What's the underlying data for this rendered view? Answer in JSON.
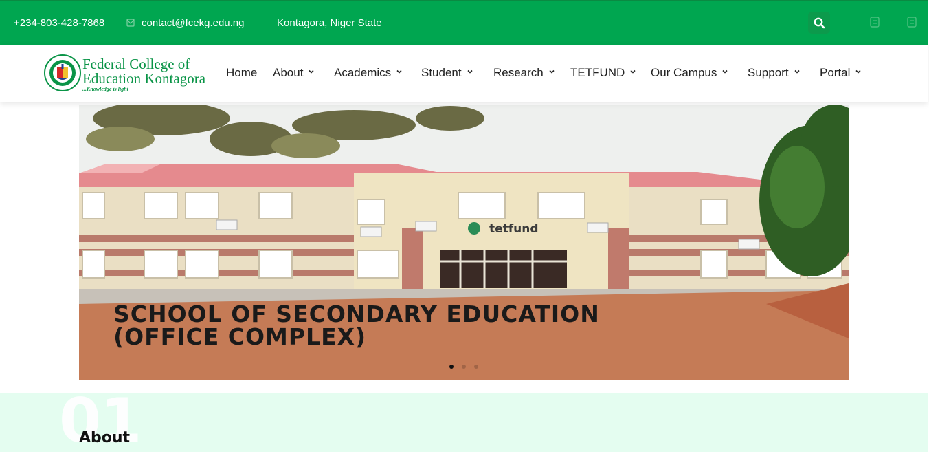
{
  "topbar": {
    "phone": "+234-803-428-7868",
    "email": "contact@fcekg.edu.ng",
    "location": "Kontagora, Niger State",
    "bg_color": "#00a650",
    "icons": [
      "mail-icon",
      "search-icon",
      "social-icon-1",
      "social-icon-2"
    ]
  },
  "logo": {
    "line1": "Federal College of",
    "line2": "Education Kontagora",
    "motto": "...Knowledge is light",
    "brand_color": "#0a9447"
  },
  "nav": {
    "items": [
      {
        "label": "Home",
        "dropdown": false
      },
      {
        "label": "About",
        "dropdown": true
      },
      {
        "label": "Academics",
        "dropdown": true
      },
      {
        "label": "Student",
        "dropdown": true
      },
      {
        "label": "Research",
        "dropdown": true
      },
      {
        "label": "TETFUND",
        "dropdown": true
      },
      {
        "label": "Our Campus",
        "dropdown": true
      },
      {
        "label": "Support",
        "dropdown": true
      },
      {
        "label": "Portal",
        "dropdown": true
      }
    ]
  },
  "hero": {
    "caption": "SCHOOL OF SECONDARY EDUCATION\n(OFFICE COMPLEX)",
    "building_sign": "tetfund",
    "slides_count": 3,
    "active_slide": 1
  },
  "about": {
    "number": "01",
    "title": "About",
    "bg_color": "#e4fdf0"
  }
}
